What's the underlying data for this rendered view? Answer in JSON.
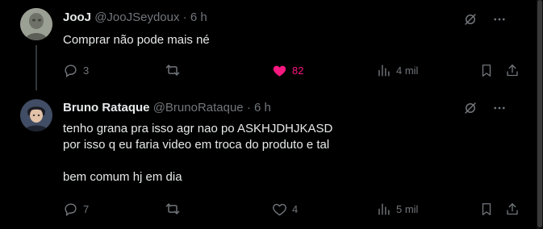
{
  "tweets": [
    {
      "name": "JooJ",
      "handle": "@JooJSeydoux",
      "separator": "·",
      "time": "6 h",
      "text": "Comprar não pode mais né",
      "replies": "3",
      "retweets": "",
      "likes": "82",
      "views": "4 mil",
      "liked": true
    },
    {
      "name": "Bruno Rataque",
      "handle": "@BrunoRataque",
      "separator": "·",
      "time": "6 h",
      "text": "tenho grana pra isso agr nao po ASKHJDHJKASD\npor isso q eu faria video em troca do produto e tal\n\nbem comum hj em dia",
      "replies": "7",
      "retweets": "",
      "likes": "4",
      "views": "5 mil",
      "liked": false
    }
  ],
  "colors": {
    "background": "#000000",
    "text": "#e7e9ea",
    "muted": "#71767b",
    "like_active": "#f91880"
  },
  "icons": [
    "reply-icon",
    "retweet-icon",
    "like-icon",
    "views-icon",
    "bookmark-icon",
    "share-icon",
    "grok-icon",
    "more-icon"
  ]
}
